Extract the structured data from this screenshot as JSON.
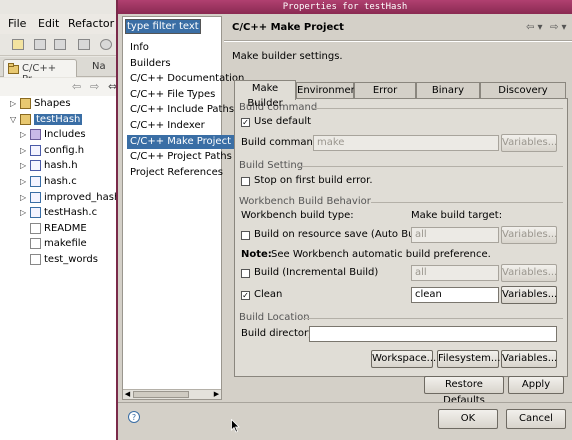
{
  "ide": {
    "menu": [
      "File",
      "Edit",
      "Refactor"
    ],
    "view_tab": "C/C++ Pr...",
    "view_tab2": "Na",
    "tree": [
      {
        "label": "Shapes",
        "twisty": "▷",
        "icon": "project-folder-icon",
        "indent": 0
      },
      {
        "label": "testHash",
        "twisty": "▽",
        "icon": "project-folder-icon",
        "indent": 0,
        "selected": true
      },
      {
        "label": "Includes",
        "twisty": "▷",
        "icon": "includes-folder-icon",
        "indent": 1
      },
      {
        "label": "config.h",
        "twisty": "▷",
        "icon": "header-file-icon",
        "indent": 1
      },
      {
        "label": "hash.h",
        "twisty": "▷",
        "icon": "header-file-icon",
        "indent": 1
      },
      {
        "label": "hash.c",
        "twisty": "▷",
        "icon": "c-file-icon",
        "indent": 1
      },
      {
        "label": "improved_hash.c",
        "twisty": "▷",
        "icon": "c-file-icon",
        "indent": 1
      },
      {
        "label": "testHash.c",
        "twisty": "▷",
        "icon": "c-file-icon",
        "indent": 1
      },
      {
        "label": "README",
        "twisty": "",
        "icon": "text-file-icon",
        "indent": 1
      },
      {
        "label": "makefile",
        "twisty": "",
        "icon": "text-file-icon",
        "indent": 1
      },
      {
        "label": "test_words",
        "twisty": "",
        "icon": "text-file-icon",
        "indent": 1
      }
    ]
  },
  "dialog": {
    "title": "Properties for testHash",
    "filter_placeholder": "type filter text",
    "nav": [
      "Info",
      "Builders",
      "C/C++ Documentation",
      "C/C++ File Types",
      "C/C++ Include Paths a",
      "C/C++ Indexer",
      "C/C++ Make Project",
      "C/C++ Project Paths",
      "Project References"
    ],
    "nav_selected_index": 6,
    "page_heading": "C/C++ Make Project",
    "page_description": "Make builder settings.",
    "tabs": [
      "Make Builder",
      "Environment",
      "Error Parsers",
      "Binary Parser",
      "Discovery Options"
    ],
    "active_tab_index": 0,
    "build_command": {
      "group": "Build command",
      "use_default_label": "Use default",
      "use_default_checked": true,
      "command_label": "Build command:",
      "command_value": "make",
      "variables": "Variables..."
    },
    "build_setting": {
      "group": "Build Setting",
      "stop_label": "Stop on first build error.",
      "stop_checked": false
    },
    "behavior": {
      "group": "Workbench Build Behavior",
      "type_header": "Workbench build type:",
      "target_header": "Make build target:",
      "auto_label": "Build on resource save (Auto Build)",
      "auto_checked": false,
      "auto_target": "all",
      "note_bold": "Note:",
      "note_text": "See Workbench automatic build preference.",
      "incremental_label": "Build (Incremental Build)",
      "incremental_checked": false,
      "incremental_target": "all",
      "clean_label": "Clean",
      "clean_checked": true,
      "clean_target": "clean",
      "variables": "Variables..."
    },
    "location": {
      "group": "Build Location",
      "dir_label": "Build directory:",
      "dir_value": "",
      "workspace": "Workspace...",
      "filesystem": "Filesystem...",
      "variables": "Variables..."
    },
    "restore_defaults": "Restore Defaults",
    "apply": "Apply",
    "ok": "OK",
    "cancel": "Cancel",
    "help_glyph": "?"
  }
}
